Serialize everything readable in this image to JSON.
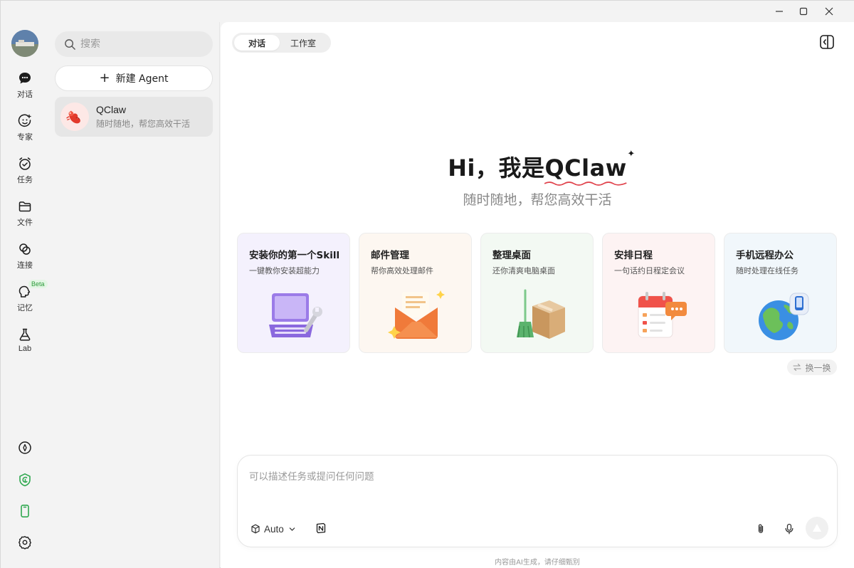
{
  "window": {
    "controls": [
      "minimize",
      "maximize",
      "close"
    ]
  },
  "rail": {
    "items": [
      {
        "label": "对话",
        "icon": "chat-icon"
      },
      {
        "label": "专家",
        "icon": "expert-icon"
      },
      {
        "label": "任务",
        "icon": "task-icon"
      },
      {
        "label": "文件",
        "icon": "folder-icon"
      },
      {
        "label": "连接",
        "icon": "link-icon"
      },
      {
        "label": "记忆",
        "icon": "memory-icon",
        "badge": "Beta"
      },
      {
        "label": "Lab",
        "icon": "flask-icon"
      }
    ],
    "bottom_icons": [
      "compass-icon",
      "shield-icon",
      "phone-icon",
      "settings-icon"
    ]
  },
  "sidebar": {
    "search_placeholder": "搜索",
    "new_agent_label": "新建 Agent",
    "agents": [
      {
        "name": "QClaw",
        "subtitle": "随时随地，帮您高效干活"
      }
    ]
  },
  "main": {
    "tabs": [
      {
        "label": "对话",
        "active": true
      },
      {
        "label": "工作室",
        "active": false
      }
    ],
    "hero": {
      "greeting": "Hi，我是",
      "brand": "QClaw",
      "subtitle": "随时随地，帮您高效干活"
    },
    "cards": [
      {
        "title": "安装你的第一个Skill",
        "subtitle": "一键教你安装超能力",
        "icon": "laptop-wrench-icon",
        "bg": "#f4f1fd"
      },
      {
        "title": "邮件管理",
        "subtitle": "帮你高效处理邮件",
        "icon": "envelope-icon",
        "bg": "#fdf7f1"
      },
      {
        "title": "整理桌面",
        "subtitle": "还你清爽电脑桌面",
        "icon": "broom-box-icon",
        "bg": "#f3f9f3"
      },
      {
        "title": "安排日程",
        "subtitle": "一句话约日程定会议",
        "icon": "calendar-icon",
        "bg": "#fdf3f3"
      },
      {
        "title": "手机远程办公",
        "subtitle": "随时处理在线任务",
        "icon": "globe-phone-icon",
        "bg": "#f1f7fb"
      }
    ],
    "swap_label": "换一换",
    "composer": {
      "placeholder": "可以描述任务或提问任何问题",
      "model_label": "Auto"
    },
    "footer_note": "内容由AI生成，请仔细甄别"
  }
}
